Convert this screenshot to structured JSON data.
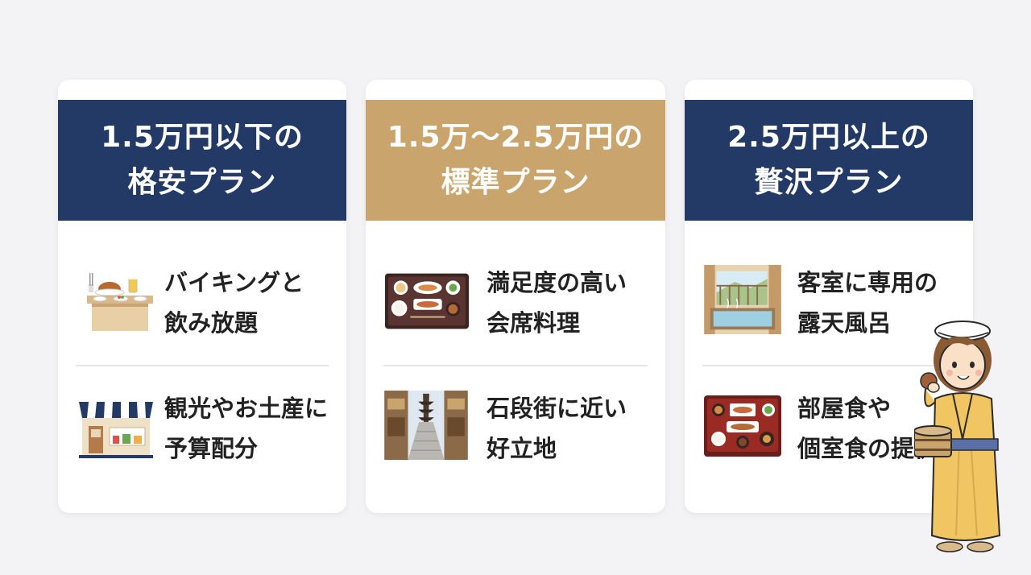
{
  "colors": {
    "navy": "#233a66",
    "gold": "#c9a46c",
    "background": "#f3f3f5",
    "card": "#ffffff"
  },
  "plans": [
    {
      "title_line1": "1.5万円以下の",
      "title_line2": "格安プラン",
      "header_color": "#233a66",
      "features": [
        {
          "line1": "バイキングと",
          "line2": "飲み放題",
          "icon": "buffet-table-icon"
        },
        {
          "line1": "観光やお土産に",
          "line2": "予算配分",
          "icon": "souvenir-shop-icon"
        }
      ]
    },
    {
      "title_line1": "1.5万〜2.5万円の",
      "title_line2": "標準プラン",
      "header_color": "#c9a46c",
      "features": [
        {
          "line1": "満足度の高い",
          "line2": "会席料理",
          "icon": "kaiseki-tray-icon"
        },
        {
          "line1": "石段街に近い",
          "line2": "好立地",
          "icon": "stone-street-icon"
        }
      ]
    },
    {
      "title_line1": "2.5万円以上の",
      "title_line2": "贅沢プラン",
      "header_color": "#233a66",
      "features": [
        {
          "line1": "客室に専用の",
          "line2": "露天風呂",
          "icon": "open-air-bath-icon"
        },
        {
          "line1": "部屋食や",
          "line2": "個室食の提供",
          "icon": "room-dining-tray-icon"
        }
      ]
    }
  ],
  "mascot": {
    "icon": "yukata-woman-icon"
  }
}
